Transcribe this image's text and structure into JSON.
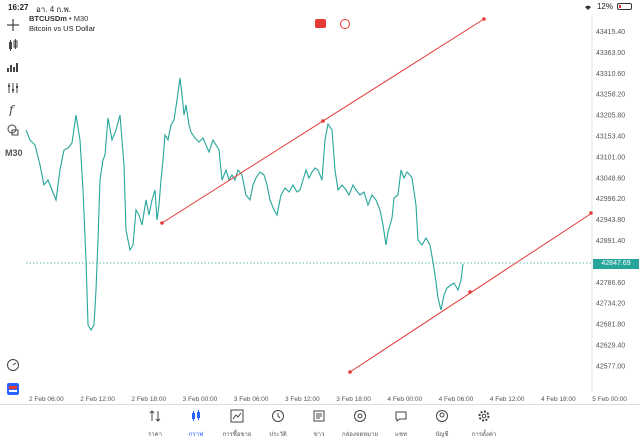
{
  "status": {
    "time": "16:27",
    "date": "อา. 4 ก.พ.",
    "battery": "12%",
    "battery_level": 0.12
  },
  "symbol": {
    "ticker": "BTCUSDm",
    "timeframe_badge": "M30",
    "description": "Bitcoin vs US Dollar"
  },
  "timeframe_label": "M30",
  "current_price": "42847.69",
  "price_axis": [
    "43415.40",
    "43363.00",
    "43310.60",
    "43258.20",
    "43205.80",
    "43153.40",
    "43101.00",
    "43048.60",
    "42996.20",
    "42943.80",
    "42891.40",
    "42839.00",
    "42786.60",
    "42734.20",
    "42681.80",
    "42629.40",
    "42577.00"
  ],
  "time_axis": [
    "2 Feb 06:00",
    "2 Feb 12:00",
    "2 Feb 18:00",
    "3 Feb 00:00",
    "3 Feb 06:00",
    "3 Feb 12:00",
    "3 Feb 18:00",
    "4 Feb 00:00",
    "4 Feb 06:00",
    "4 Feb 12:00",
    "4 Feb 18:00",
    "5 Feb 00:00"
  ],
  "nav": [
    {
      "label": "ราคา",
      "icon": "quotes-icon"
    },
    {
      "label": "กราฟ",
      "icon": "chart-candles-icon"
    },
    {
      "label": "การซื้อขาย",
      "icon": "trade-icon"
    },
    {
      "label": "ประวัติ",
      "icon": "history-icon"
    },
    {
      "label": "ข่าว",
      "icon": "news-icon"
    },
    {
      "label": "กล่องจดหมาย",
      "icon": "mailbox-icon"
    },
    {
      "label": "แชท",
      "icon": "chat-icon"
    },
    {
      "label": "บัญชี",
      "icon": "account-icon"
    },
    {
      "label": "การตั้งค่า",
      "icon": "settings-icon"
    }
  ],
  "colors": {
    "line": "#26a69a",
    "trendline": "#e53935",
    "active": "#2962ff"
  }
}
